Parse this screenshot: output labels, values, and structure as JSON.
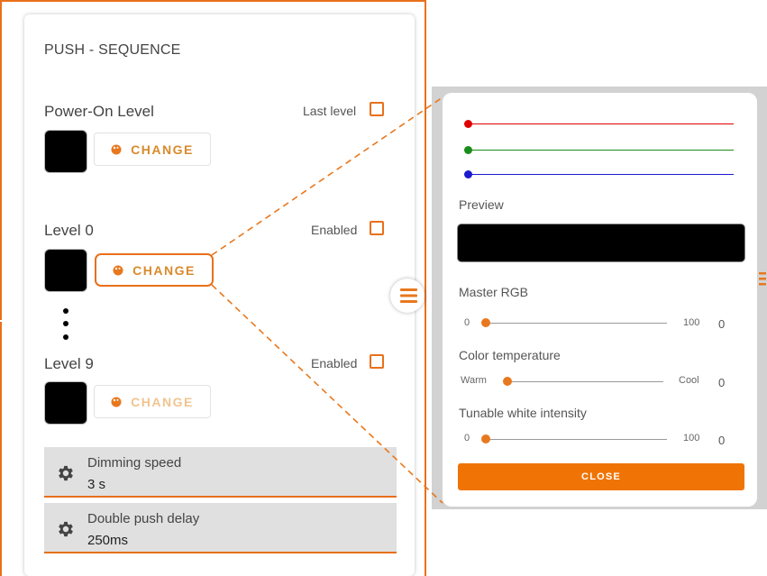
{
  "panel": {
    "title": "PUSH - SEQUENCE",
    "levels": [
      {
        "name": "Power-On Level",
        "check_label": "Last level",
        "change_label": "CHANGE",
        "color": "#000000"
      },
      {
        "name": "Level 0",
        "check_label": "Enabled",
        "change_label": "CHANGE",
        "color": "#000000"
      },
      {
        "name": "Level 9",
        "check_label": "Enabled",
        "change_label": "CHANGE",
        "color": "#000000"
      }
    ],
    "settings": [
      {
        "label": "Dimming speed",
        "value": "3 s",
        "icon": "gear-icon"
      },
      {
        "label": "Double push delay",
        "value": "250ms",
        "icon": "gear-icon"
      }
    ],
    "menu_icon": "hamburger-icon"
  },
  "popup": {
    "rgb_sliders": [
      {
        "channel": "red",
        "color": "#e00000"
      },
      {
        "channel": "green",
        "color": "#1a8c1a"
      },
      {
        "channel": "blue",
        "color": "#1a1ad0"
      }
    ],
    "preview_label": "Preview",
    "preview_color": "#000000",
    "master": {
      "label": "Master RGB",
      "min": "0",
      "max": "100",
      "value": "0"
    },
    "temperature": {
      "label": "Color temperature",
      "min": "Warm",
      "max": "Cool",
      "value": "0"
    },
    "tunable": {
      "label": "Tunable white intensity",
      "min": "0",
      "max": "100",
      "value": "0"
    },
    "close_label": "CLOSE"
  },
  "colors": {
    "accent": "#e8701a",
    "close_button": "#ef7405"
  }
}
